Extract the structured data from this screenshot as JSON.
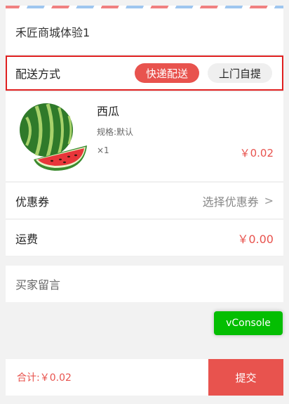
{
  "store": {
    "name": "禾匠商城体验1"
  },
  "delivery": {
    "label": "配送方式",
    "options": [
      {
        "label": "快递配送",
        "selected": true
      },
      {
        "label": "上门自提",
        "selected": false
      }
    ]
  },
  "product": {
    "name": "西瓜",
    "spec": "规格:默认",
    "qty": "×1",
    "price": "￥0.02",
    "image_icon": "watermelon"
  },
  "coupon": {
    "label": "优惠券",
    "value": "选择优惠券",
    "chevron": ">"
  },
  "freight": {
    "label": "运费",
    "value": "￥0.00"
  },
  "message": {
    "placeholder": "买家留言"
  },
  "vconsole": {
    "label": "vConsole"
  },
  "footer": {
    "total": "合计:￥0.02",
    "submit": "提交"
  },
  "colors": {
    "accent": "#e8534e",
    "vconsole_green": "#04be02"
  }
}
